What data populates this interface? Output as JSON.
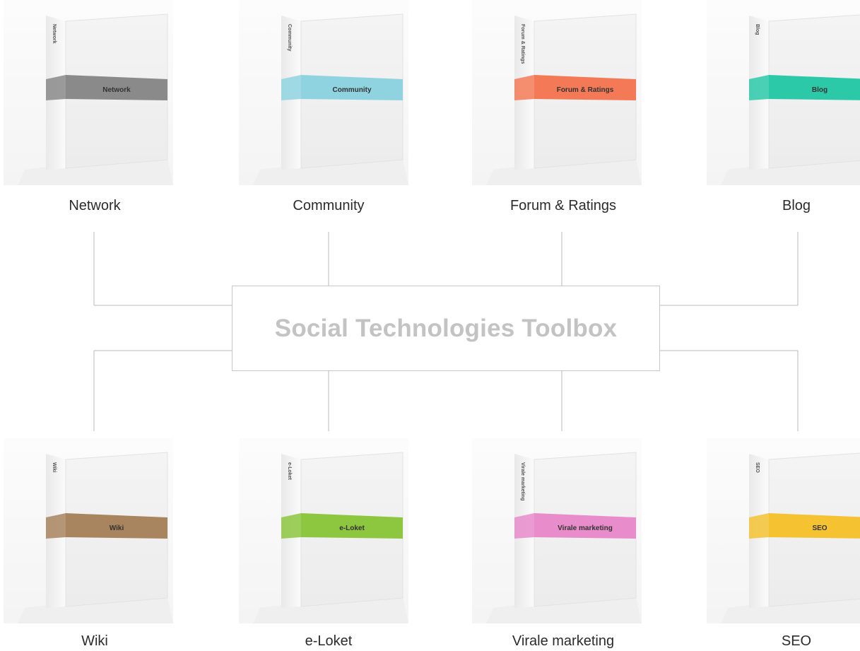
{
  "title": "Social Technologies Toolbox",
  "products": [
    {
      "name": "Network",
      "box_band_label": "Network",
      "box_spine_label": "Network",
      "color": "#8a8a8a"
    },
    {
      "name": "Community",
      "box_band_label": "Community",
      "box_spine_label": "Community",
      "color": "#8fd3e0"
    },
    {
      "name": "Forum & Ratings",
      "box_band_label": "Forum & Ratings",
      "box_spine_label": "Forum & Ratings",
      "color": "#f47a57"
    },
    {
      "name": "Blog",
      "box_band_label": "Blog",
      "box_spine_label": "Blog",
      "color": "#2bc9a8"
    },
    {
      "name": "Wiki",
      "box_band_label": "Wiki",
      "box_spine_label": "Wiki",
      "color": "#a8845f"
    },
    {
      "name": "e-Loket",
      "box_band_label": "e-Loket",
      "box_spine_label": "e-Loket",
      "color": "#8dc63f"
    },
    {
      "name": "Virale marketing",
      "box_band_label": "Virale marketing",
      "box_spine_label": "Virale marketing",
      "color": "#e88ccb"
    },
    {
      "name": "SEO",
      "box_band_label": "SEO",
      "box_spine_label": "SEO",
      "color": "#f5c232"
    }
  ]
}
